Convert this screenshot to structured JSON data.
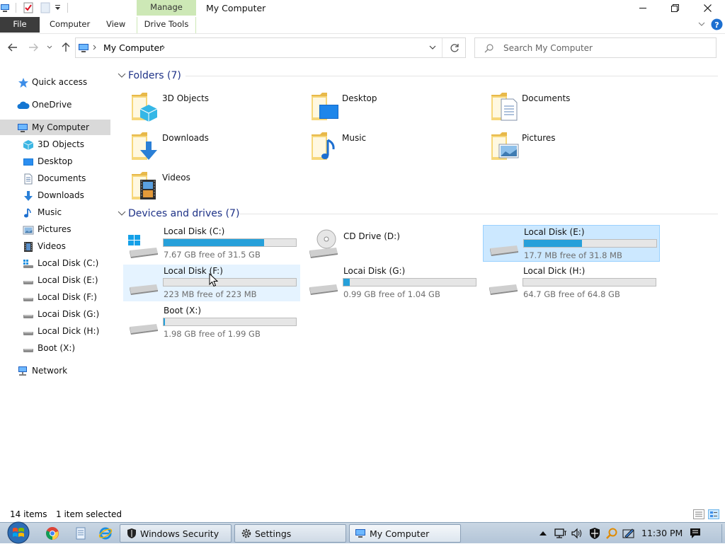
{
  "window": {
    "title": "My Computer",
    "manage_tab": "Manage"
  },
  "ribbon": {
    "file": "File",
    "tabs": [
      "Computer",
      "View"
    ],
    "drive_tools": "Drive Tools"
  },
  "address": {
    "path": "My Computer",
    "search_placeholder": "Search My Computer"
  },
  "nav": {
    "quick_access": "Quick access",
    "onedrive": "OneDrive",
    "my_computer": "My Computer",
    "children": [
      "3D Objects",
      "Desktop",
      "Documents",
      "Downloads",
      "Music",
      "Pictures",
      "Videos",
      "Local Disk (C:)",
      "Local Disk (E:)",
      "Local Disk (F:)",
      "Locai Disk (G:)",
      "Local Dick (H:)",
      "Boot (X:)"
    ],
    "network": "Network"
  },
  "folders": {
    "header": "Folders (7)",
    "items": [
      "3D Objects",
      "Desktop",
      "Documents",
      "Downloads",
      "Music",
      "Pictures",
      "Videos"
    ]
  },
  "drives": {
    "header": "Devices and drives (7)",
    "items": [
      {
        "name": "Local Disk (C:)",
        "free": "7.67 GB free of 31.5 GB",
        "used": 0.76
      },
      {
        "name": "CD Drive (D:)",
        "free": "",
        "used": null
      },
      {
        "name": "Local Disk (E:)",
        "free": "17.7 MB free of 31.8 MB",
        "used": 0.44
      },
      {
        "name": "Local Disk (F:)",
        "free": "223 MB free of 223 MB",
        "used": 0.0
      },
      {
        "name": "Locai Disk (G:)",
        "free": "0.99 GB free of 1.04 GB",
        "used": 0.05
      },
      {
        "name": "Local Dick (H:)",
        "free": "64.7 GB free of 64.8 GB",
        "used": 0.0
      },
      {
        "name": "Boot (X:)",
        "free": "1.98 GB free of 1.99 GB",
        "used": 0.01
      }
    ]
  },
  "status": {
    "items": "14 items",
    "selected": "1 item selected"
  },
  "taskbar": {
    "buttons": [
      "Windows Security",
      "Settings",
      "My Computer"
    ],
    "clock": "11:30 PM"
  },
  "colors": {
    "accent": "#26a0da",
    "selection": "#cce8ff",
    "group_header": "#1e3287",
    "manage_tab": "#cde8b6"
  }
}
